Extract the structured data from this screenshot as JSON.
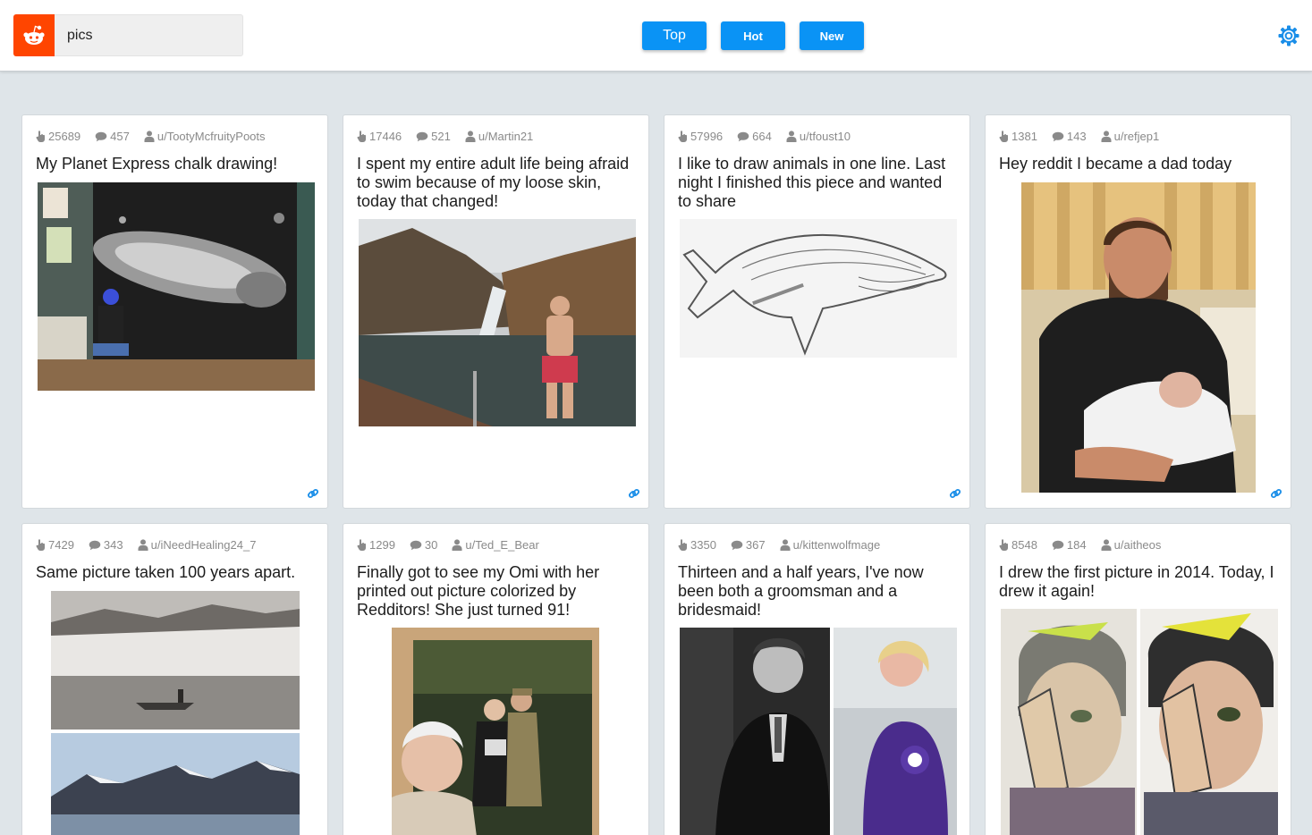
{
  "search": {
    "value": "pics"
  },
  "sort": {
    "top": "Top",
    "hot": "Hot",
    "new": "New"
  },
  "colors": {
    "brand": "#ff4500",
    "accent": "#0a93f5",
    "background": "#dfe5e9"
  },
  "posts": [
    {
      "upvotes": "25689",
      "comments": "457",
      "user": "u/TootyMcfruityPoots",
      "title": "My Planet Express chalk drawing!"
    },
    {
      "upvotes": "17446",
      "comments": "521",
      "user": "u/Martin21",
      "title": "I spent my entire adult life being afraid to swim because of my loose skin, today that changed!"
    },
    {
      "upvotes": "57996",
      "comments": "664",
      "user": "u/tfoust10",
      "title": "I like to draw animals in one line. Last night I finished this piece and wanted to share"
    },
    {
      "upvotes": "1381",
      "comments": "143",
      "user": "u/refjep1",
      "title": "Hey reddit I became a dad today"
    },
    {
      "upvotes": "7429",
      "comments": "343",
      "user": "u/iNeedHealing24_7",
      "title": "Same picture taken 100 years apart."
    },
    {
      "upvotes": "1299",
      "comments": "30",
      "user": "u/Ted_E_Bear",
      "title": "Finally got to see my Omi with her printed out picture colorized by Redditors! She just turned 91!"
    },
    {
      "upvotes": "3350",
      "comments": "367",
      "user": "u/kittenwolfmage",
      "title": "Thirteen and a half years, I've now been both a groomsman and a bridesmaid!"
    },
    {
      "upvotes": "8548",
      "comments": "184",
      "user": "u/aitheos",
      "title": "I drew the first picture in 2014. Today, I drew it again!"
    }
  ]
}
